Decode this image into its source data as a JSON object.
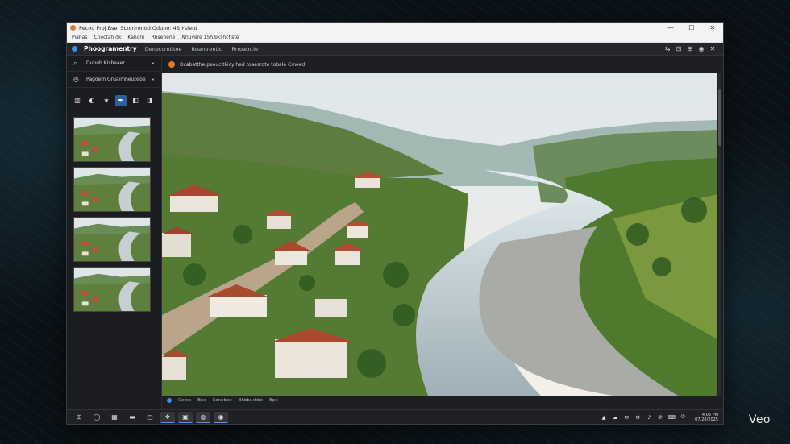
{
  "window": {
    "title": "Pecou Proj Bsel Stxorjronod Oduno: 4S Ysleut",
    "controls": [
      "—",
      "☐",
      "✕"
    ]
  },
  "menubar": [
    "Piahas",
    "Cnoctah dk",
    "Kahorn",
    "Rhsehene",
    "Nhuvere 15h.bkshchste"
  ],
  "app_header": {
    "brand": "Phoogramentry",
    "nav": [
      "Denoccrntitoe",
      "Rnantrentic",
      "Rrroatntie"
    ],
    "buttons": [
      "⇆",
      "⊡",
      "⊞",
      "◉",
      "✕"
    ]
  },
  "sidebar": {
    "rows": [
      {
        "icon": "⌕",
        "label": "Dubuh Kisheaer",
        "dot": "•"
      },
      {
        "icon": "◴",
        "label": "Pagoem Gruaimheuosoe",
        "dot": "•"
      }
    ],
    "tools": [
      "▥",
      "◐",
      "★",
      "✒",
      "◧",
      "◨"
    ]
  },
  "tab": {
    "label": "Dcabatthe peoucitkicy hed toaesrdte tobale Cmeed"
  },
  "status_bar": [
    "Cereo",
    "Bne",
    "Sonoboo",
    "Bhbburbbe",
    "Bpe"
  ],
  "taskbar": {
    "items": [
      "⊞",
      "◯",
      "▦",
      "▬",
      "◰",
      "❖",
      "▣",
      "◍",
      "◉"
    ],
    "tray": [
      "▲",
      "☁",
      "✉",
      "⚙",
      "♪",
      "✆",
      "⌨",
      "⏻"
    ],
    "clock_time": "4:05 PM",
    "clock_date": "07/28/2025"
  },
  "watermark": "Veo",
  "colors": {
    "accent": "#2d5f9a",
    "brand_dot": "#3a8ee6",
    "tab_icon": "#e07a2c"
  }
}
